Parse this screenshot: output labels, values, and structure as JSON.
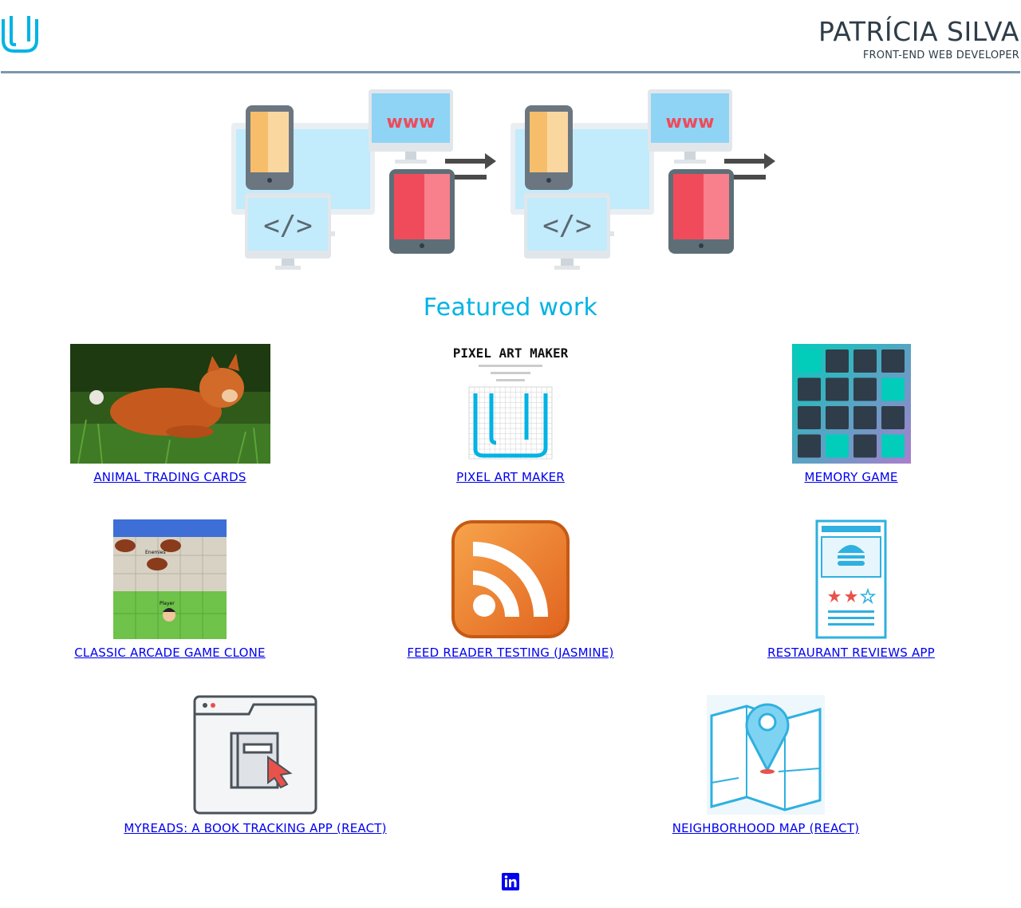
{
  "header": {
    "logo": "udacity-logo-icon",
    "name": "PATRÍCIA SILVA",
    "role": "FRONT-END WEB DEVELOPER"
  },
  "hero": {
    "image": "responsive-devices-illustration"
  },
  "featured": {
    "title": "Featured work"
  },
  "projects": [
    {
      "label": "ANIMAL TRADING CARDS",
      "image": "cat-photo"
    },
    {
      "label": "PIXEL ART MAKER",
      "image": "pixel-art-maker-screenshot",
      "image_title": "PIXEL ART MAKER"
    },
    {
      "label": "MEMORY GAME",
      "image": "memory-game-screenshot"
    },
    {
      "label": "CLASSIC ARCADE GAME CLONE",
      "image": "arcade-game-screenshot",
      "image_text_1": "Enemies",
      "image_text_2": "Player"
    },
    {
      "label": "FEED READER TESTING (JASMINE)",
      "image": "rss-icon"
    },
    {
      "label": "RESTAURANT REVIEWS APP",
      "image": "restaurant-menu-icon"
    },
    {
      "label": "MYREADS: A BOOK TRACKING APP (REACT)",
      "image": "book-browser-icon"
    },
    {
      "label": "NEIGHBORHOOD MAP (REACT)",
      "image": "map-pin-icon"
    }
  ],
  "footer": {
    "social": "linkedin-icon"
  },
  "colors": {
    "accent": "#02b3e4",
    "text": "#2e3d49",
    "divider": "#7d97ad",
    "link": "#0000ee"
  }
}
